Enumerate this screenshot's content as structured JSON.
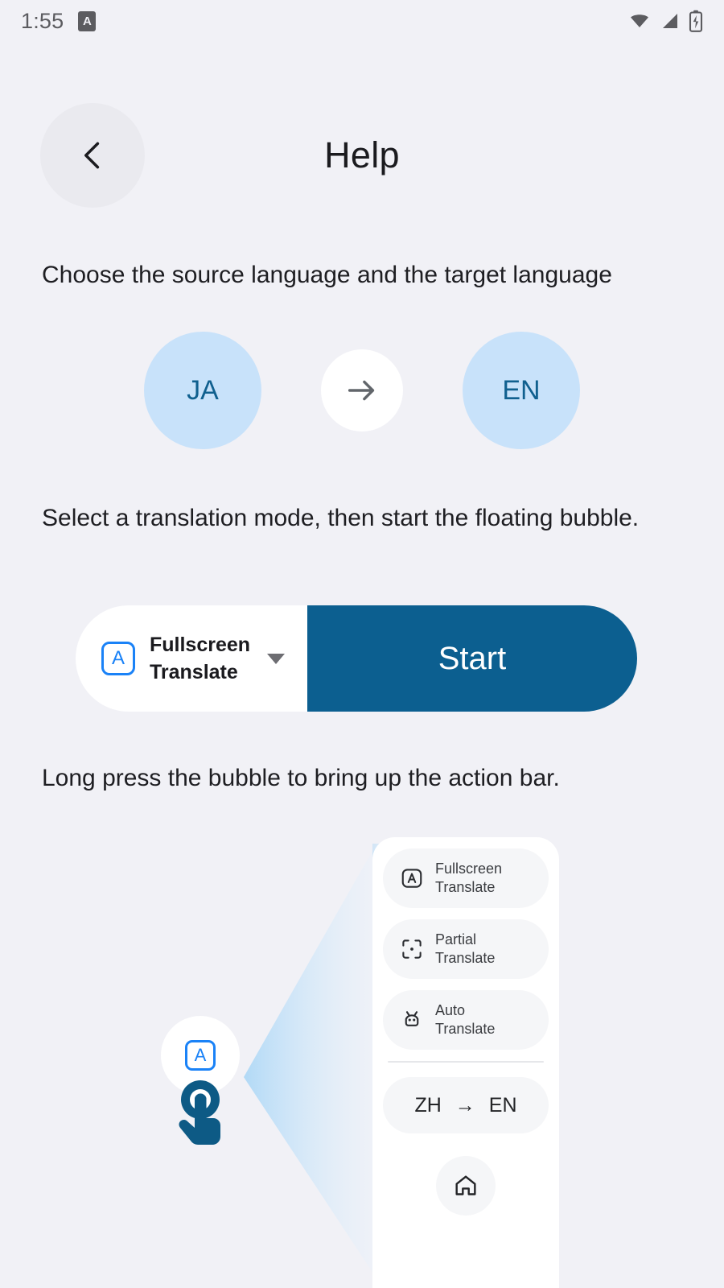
{
  "status_bar": {
    "time": "1:55",
    "notification_icon_letter": "A",
    "icons": [
      "wifi-icon",
      "cellular-signal-icon",
      "battery-charging-icon"
    ]
  },
  "header": {
    "title": "Help",
    "back_icon": "chevron-left-icon"
  },
  "sections": {
    "language_instruction": "Choose the source language and the target language",
    "mode_instruction": "Select a translation mode, then start the floating bubble.",
    "longpress_instruction": "Long press the bubble to bring up the action bar."
  },
  "language_selector": {
    "source": "JA",
    "target": "EN",
    "swap_icon": "arrow-right-icon"
  },
  "mode_bar": {
    "mode_icon_letter": "A",
    "mode_label_line1": "Fullscreen",
    "mode_label_line2": "Translate",
    "dropdown_icon": "caret-down-icon",
    "start_label": "Start"
  },
  "action_bar_illustration": {
    "bubble_icon_letter": "A",
    "items": [
      {
        "icon": "fullscreen-translate-icon",
        "line1": "Fullscreen",
        "line2": "Translate"
      },
      {
        "icon": "partial-translate-icon",
        "line1": "Partial",
        "line2": "Translate"
      },
      {
        "icon": "auto-translate-icon",
        "line1": "Auto",
        "line2": "Translate"
      }
    ],
    "language_pill": {
      "source": "ZH",
      "arrow": "→",
      "target": "EN"
    },
    "home_icon": "home-icon"
  },
  "colors": {
    "background": "#f1f1f6",
    "accent_blue": "#0c5f90",
    "light_blue": "#c8e2fa",
    "icon_blue": "#1a82f7"
  }
}
